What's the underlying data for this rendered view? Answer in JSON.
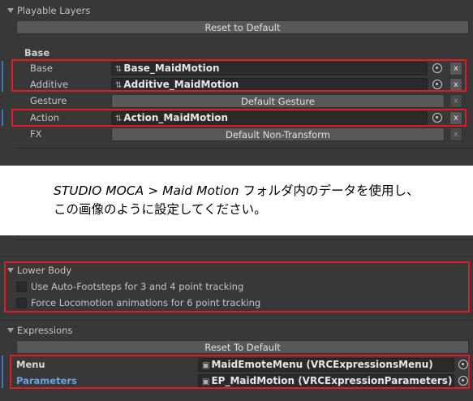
{
  "playable_layers": {
    "title": "Playable Layers",
    "reset_label": "Reset to Default",
    "group_title": "Base",
    "rows": [
      {
        "label": "Base",
        "value": "Base_MaidMotion"
      },
      {
        "label": "Additive",
        "value": "Additive_MaidMotion"
      },
      {
        "label": "Gesture",
        "value": "Default Gesture"
      },
      {
        "label": "Action",
        "value": "Action_MaidMotion"
      },
      {
        "label": "FX",
        "value": "Default Non-Transform"
      }
    ],
    "x_label": "x"
  },
  "note": {
    "line1_prefix": "STUDIO MOCA > Maid Motion",
    "line1_suffix": " フォルダ内のデータを使用し、",
    "line2": "この画像のように設定してください。"
  },
  "lower_body": {
    "title": "Lower Body",
    "options": [
      "Use Auto-Footsteps for 3 and 4 point tracking",
      "Force Locomotion animations for 6 point tracking"
    ]
  },
  "expressions": {
    "title": "Expressions",
    "reset_label": "Reset To Default",
    "menu_label": "Menu",
    "menu_value": "MaidEmoteMenu (VRCExpressionsMenu)",
    "params_label": "Parameters",
    "params_value": "EP_MaidMotion (VRCExpressionParameters)"
  },
  "colors": {
    "highlight_border": "#e01b24",
    "selection_bar": "#3a79bb",
    "parameters_label": "#6aa3e8"
  },
  "icons": [
    "foldout-arrow-icon",
    "asset-link-icon",
    "object-picker-icon",
    "menu-asset-icon"
  ]
}
